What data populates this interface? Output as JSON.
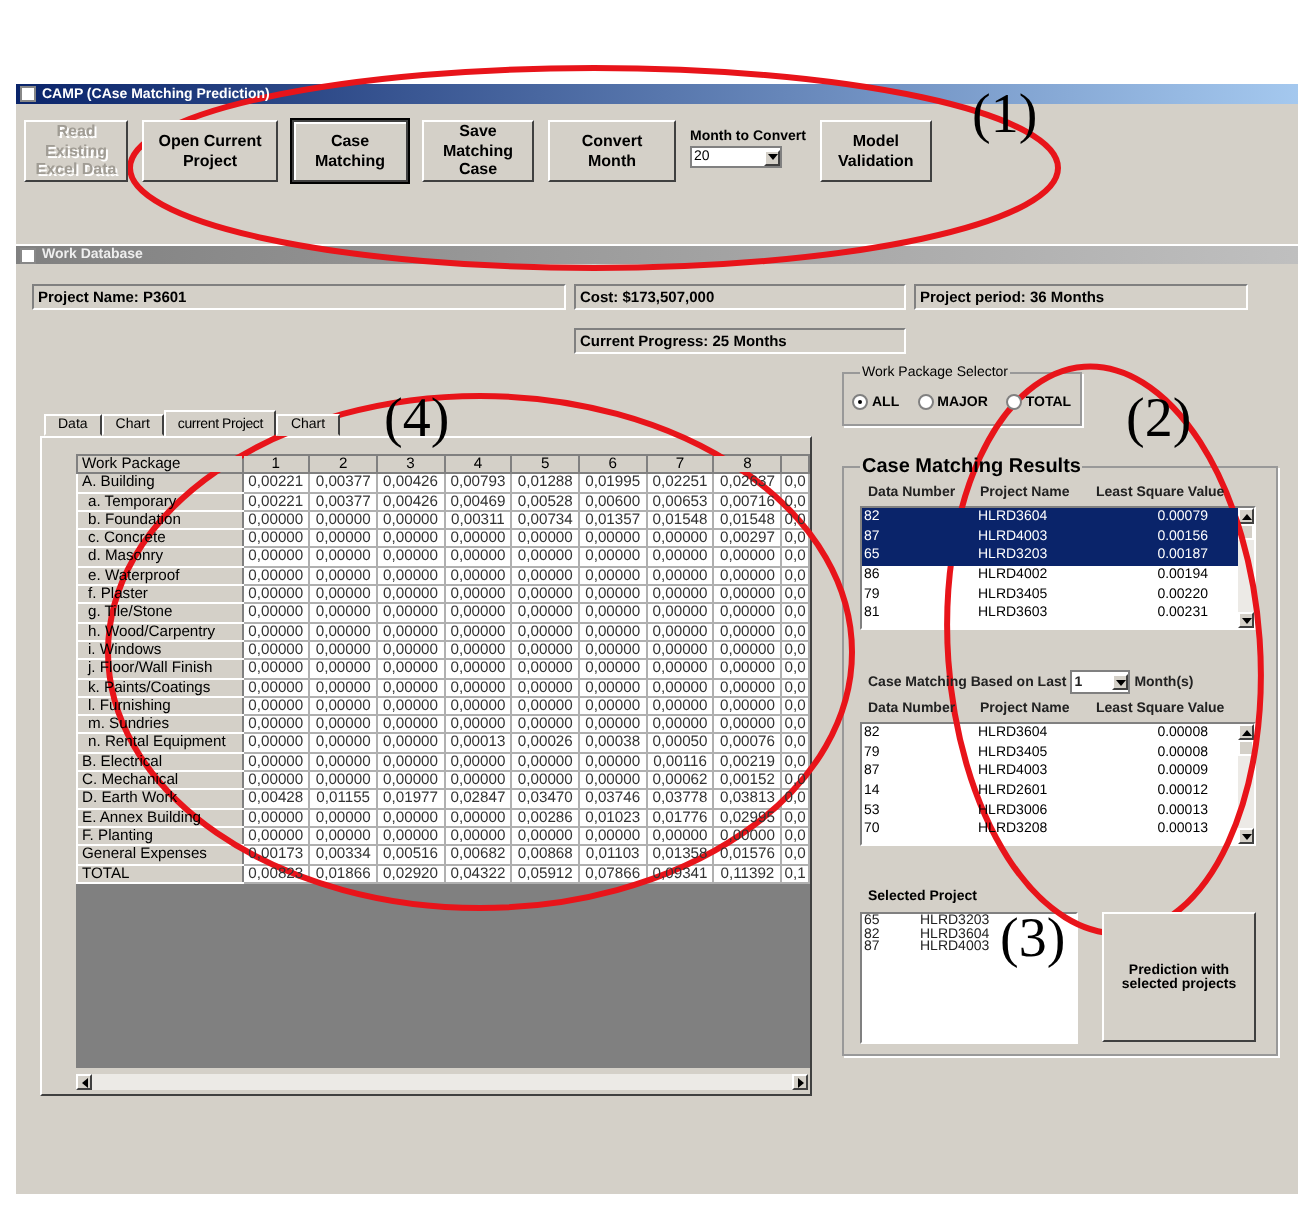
{
  "app_window": {
    "title": "CAMP (CAse Matching Prediction)"
  },
  "toolbar": [
    {
      "kind": "button",
      "label": "Read Existing Excel Data",
      "disabled": true,
      "selected": false
    },
    {
      "kind": "button",
      "label": "Open Current Project",
      "disabled": false,
      "selected": false
    },
    {
      "kind": "button",
      "label": "Case Matching",
      "disabled": false,
      "selected": true
    },
    {
      "kind": "button",
      "label": "Save Matching Case",
      "disabled": false,
      "selected": false
    },
    {
      "kind": "button",
      "label": "Convert Month",
      "disabled": false,
      "selected": false
    },
    {
      "kind": "combo",
      "label": "Month to Convert",
      "value": "20"
    },
    {
      "kind": "button",
      "label": "Model Validation",
      "disabled": false,
      "selected": false
    }
  ],
  "inner_window": {
    "title": "Work Database"
  },
  "project_info": {
    "name": "Project Name: P3601",
    "cost": "Cost: $173,507,000",
    "period": "Project period: 36 Months",
    "progress": "Current Progress: 25 Months"
  },
  "work_package_selector": {
    "title": "Work Package Selector",
    "options": [
      {
        "label": "ALL",
        "selected": true
      },
      {
        "label": "MAJOR",
        "selected": false
      },
      {
        "label": "TOTAL",
        "selected": false
      }
    ]
  },
  "tabs": [
    {
      "label": "Data",
      "selected": false
    },
    {
      "label": "Chart",
      "selected": false
    },
    {
      "label": "current Project",
      "selected": true
    },
    {
      "label": "Chart",
      "selected": false
    }
  ],
  "grid": {
    "row_header_title": "Work Package",
    "columns": [
      "1",
      "2",
      "3",
      "4",
      "5",
      "6",
      "7",
      "8"
    ],
    "rows": [
      {
        "label": "A. Building",
        "cells": [
          "0,00221",
          "0,00377",
          "0,00426",
          "0,00793",
          "0,01288",
          "0,01995",
          "0,02251",
          "0,02637",
          "0,0"
        ],
        "children": [
          {
            "label": "a. Temporary",
            "cells": [
              "0,00221",
              "0,00377",
              "0,00426",
              "0,00469",
              "0,00528",
              "0,00600",
              "0,00653",
              "0,00716",
              "0,0"
            ]
          },
          {
            "label": "b. Foundation",
            "cells": [
              "0,00000",
              "0,00000",
              "0,00000",
              "0,00311",
              "0,00734",
              "0,01357",
              "0,01548",
              "0,01548",
              "0,0"
            ]
          },
          {
            "label": "c. Concrete",
            "cells": [
              "0,00000",
              "0,00000",
              "0,00000",
              "0,00000",
              "0,00000",
              "0,00000",
              "0,00000",
              "0,00297",
              "0,0"
            ]
          },
          {
            "label": "d. Masonry",
            "cells": [
              "0,00000",
              "0,00000",
              "0,00000",
              "0,00000",
              "0,00000",
              "0,00000",
              "0,00000",
              "0,00000",
              "0,0"
            ]
          },
          {
            "label": "e. Waterproof",
            "cells": [
              "0,00000",
              "0,00000",
              "0,00000",
              "0,00000",
              "0,00000",
              "0,00000",
              "0,00000",
              "0,00000",
              "0,0"
            ]
          },
          {
            "label": "f. Plaster",
            "cells": [
              "0,00000",
              "0,00000",
              "0,00000",
              "0,00000",
              "0,00000",
              "0,00000",
              "0,00000",
              "0,00000",
              "0,0"
            ]
          },
          {
            "label": "g. Tile/Stone",
            "cells": [
              "0,00000",
              "0,00000",
              "0,00000",
              "0,00000",
              "0,00000",
              "0,00000",
              "0,00000",
              "0,00000",
              "0,0"
            ]
          },
          {
            "label": "h. Wood/Carpentry",
            "cells": [
              "0,00000",
              "0,00000",
              "0,00000",
              "0,00000",
              "0,00000",
              "0,00000",
              "0,00000",
              "0,00000",
              "0,0"
            ]
          },
          {
            "label": "i. Windows",
            "cells": [
              "0,00000",
              "0,00000",
              "0,00000",
              "0,00000",
              "0,00000",
              "0,00000",
              "0,00000",
              "0,00000",
              "0,0"
            ]
          },
          {
            "label": "j. Floor/Wall Finish",
            "cells": [
              "0,00000",
              "0,00000",
              "0,00000",
              "0,00000",
              "0,00000",
              "0,00000",
              "0,00000",
              "0,00000",
              "0,0"
            ]
          },
          {
            "label": "k. Paints/Coatings",
            "cells": [
              "0,00000",
              "0,00000",
              "0,00000",
              "0,00000",
              "0,00000",
              "0,00000",
              "0,00000",
              "0,00000",
              "0,0"
            ]
          },
          {
            "label": "l. Furnishing",
            "cells": [
              "0,00000",
              "0,00000",
              "0,00000",
              "0,00000",
              "0,00000",
              "0,00000",
              "0,00000",
              "0,00000",
              "0,0"
            ]
          },
          {
            "label": "m. Sundries",
            "cells": [
              "0,00000",
              "0,00000",
              "0,00000",
              "0,00000",
              "0,00000",
              "0,00000",
              "0,00000",
              "0,00000",
              "0,0"
            ]
          },
          {
            "label": "n. Rental Equipment",
            "cells": [
              "0,00000",
              "0,00000",
              "0,00000",
              "0,00013",
              "0,00026",
              "0,00038",
              "0,00050",
              "0,00076",
              "0,0"
            ]
          }
        ]
      },
      {
        "label": "B. Electrical",
        "cells": [
          "0,00000",
          "0,00000",
          "0,00000",
          "0,00000",
          "0,00000",
          "0,00000",
          "0,00116",
          "0,00219",
          "0,0"
        ]
      },
      {
        "label": "C. Mechanical",
        "cells": [
          "0,00000",
          "0,00000",
          "0,00000",
          "0,00000",
          "0,00000",
          "0,00000",
          "0,00062",
          "0,00152",
          "0,0"
        ]
      },
      {
        "label": "D. Earth Work",
        "cells": [
          "0,00428",
          "0,01155",
          "0,01977",
          "0,02847",
          "0,03470",
          "0,03746",
          "0,03778",
          "0,03813",
          "0,0"
        ]
      },
      {
        "label": "E. Annex Building",
        "cells": [
          "0,00000",
          "0,00000",
          "0,00000",
          "0,00000",
          "0,00286",
          "0,01023",
          "0,01776",
          "0,02995",
          "0,0"
        ]
      },
      {
        "label": "F. Planting",
        "cells": [
          "0,00000",
          "0,00000",
          "0,00000",
          "0,00000",
          "0,00000",
          "0,00000",
          "0,00000",
          "0,00000",
          "0,0"
        ]
      },
      {
        "label": "General Expenses",
        "cells": [
          "0,00173",
          "0,00334",
          "0,00516",
          "0,00682",
          "0,00868",
          "0,01103",
          "0,01358",
          "0,01576",
          "0,0"
        ]
      },
      {
        "label": "TOTAL",
        "cells": [
          "0,00823",
          "0,01866",
          "0,02920",
          "0,04322",
          "0,05912",
          "0,07866",
          "0,09341",
          "0,11392",
          "0,1"
        ]
      }
    ]
  },
  "case_matching": {
    "title": "Case Matching Results",
    "columns": [
      "Data Number",
      "Project Name",
      "Least Square Value"
    ],
    "results": [
      {
        "data_number": "82",
        "project_name": "HLRD3604",
        "value": "0.00079",
        "selected": true
      },
      {
        "data_number": "87",
        "project_name": "HLRD4003",
        "value": "0.00156",
        "selected": true
      },
      {
        "data_number": "65",
        "project_name": "HLRD3203",
        "value": "0.00187",
        "selected": true
      },
      {
        "data_number": "86",
        "project_name": "HLRD4002",
        "value": "0.00194",
        "selected": false
      },
      {
        "data_number": "79",
        "project_name": "HLRD3405",
        "value": "0.00220",
        "selected": false
      },
      {
        "data_number": "81",
        "project_name": "HLRD3603",
        "value": "0.00231",
        "selected": false
      }
    ],
    "based_on": {
      "label": "Case Matching Based on Last",
      "value": "1",
      "unit": "Month(s)"
    },
    "columns_2": [
      "Data Number",
      "Project Name",
      "Least Square Value"
    ],
    "results_2": [
      {
        "data_number": "82",
        "project_name": "HLRD3604",
        "value": "0.00008",
        "selected": false
      },
      {
        "data_number": "79",
        "project_name": "HLRD3405",
        "value": "0.00008",
        "selected": false
      },
      {
        "data_number": "87",
        "project_name": "HLRD4003",
        "value": "0.00009",
        "selected": false
      },
      {
        "data_number": "14",
        "project_name": "HLRD2601",
        "value": "0.00012",
        "selected": false
      },
      {
        "data_number": "53",
        "project_name": "HLRD3006",
        "value": "0.00013",
        "selected": false
      },
      {
        "data_number": "70",
        "project_name": "HLRD3208",
        "value": "0.00013",
        "selected": false
      }
    ],
    "selected_project": {
      "label": "Selected Project",
      "items": [
        {
          "data_number": "65",
          "project_name": "HLRD3203"
        },
        {
          "data_number": "82",
          "project_name": "HLRD3604"
        },
        {
          "data_number": "87",
          "project_name": "HLRD4003"
        }
      ]
    },
    "predict_button": "Prediction with selected projects"
  },
  "annotations": [
    {
      "label": "(1)"
    },
    {
      "label": "(2)"
    },
    {
      "label": "(3)"
    },
    {
      "label": "(4)"
    }
  ]
}
